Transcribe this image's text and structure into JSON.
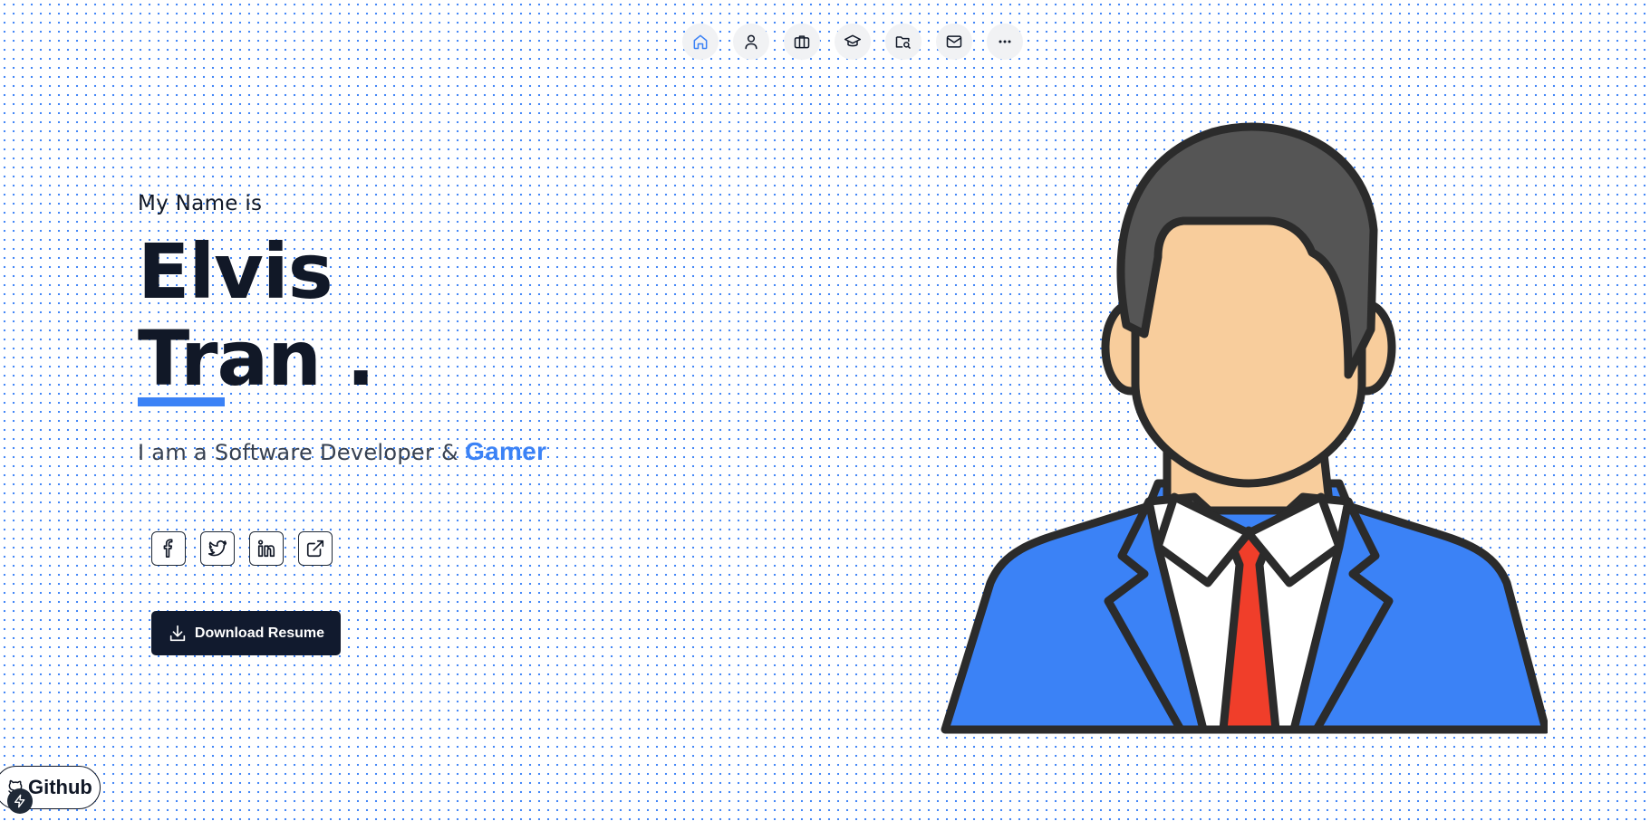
{
  "nav": {
    "items": [
      {
        "icon": "home-icon",
        "active": true
      },
      {
        "icon": "user-icon",
        "active": false
      },
      {
        "icon": "briefcase-icon",
        "active": false
      },
      {
        "icon": "graduation-cap-icon",
        "active": false
      },
      {
        "icon": "folder-search-icon",
        "active": false
      },
      {
        "icon": "mail-icon",
        "active": false
      },
      {
        "icon": "more-icon",
        "active": false
      }
    ]
  },
  "hero": {
    "intro": "My Name is",
    "first_name": "Elvis",
    "last_name": "Tran .",
    "tagline_prefix": "I am a Software Developer &",
    "tagline_accent": "Gamer"
  },
  "socials": [
    {
      "icon": "facebook-icon"
    },
    {
      "icon": "twitter-icon"
    },
    {
      "icon": "linkedin-icon"
    },
    {
      "icon": "external-link-icon"
    }
  ],
  "actions": {
    "download_label": "Download Resume"
  },
  "badge": {
    "label": "Github"
  },
  "colors": {
    "accent": "#3b82f6",
    "dark": "#111a2e",
    "suit": "#3b82f6",
    "tie": "#f03e2a",
    "skin": "#f8cd9c",
    "hair": "#555555"
  }
}
